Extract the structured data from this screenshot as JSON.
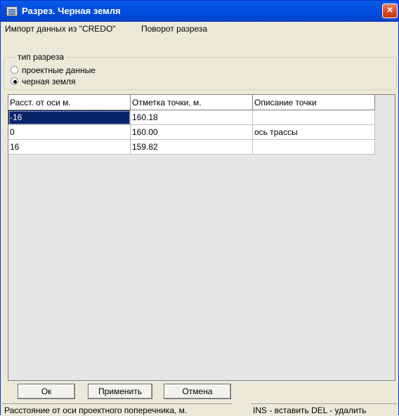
{
  "window": {
    "title": "Разрез. Черная земля",
    "close_glyph": "×"
  },
  "menu": {
    "items": [
      "Импорт данных  из \"CREDO\"",
      "Поворот разреза"
    ]
  },
  "cut_type": {
    "legend": "тип разреза",
    "options": [
      {
        "label": "проектные данные",
        "selected": false
      },
      {
        "label": "черная земля",
        "selected": true
      }
    ]
  },
  "table": {
    "headers": [
      "Расст. от оси  м.",
      "Отметка точки, м.",
      "Описание точки"
    ],
    "rows": [
      [
        "-16",
        "160.18",
        ""
      ],
      [
        "0",
        "160.00",
        "ось трассы"
      ],
      [
        "16",
        "159.82",
        ""
      ]
    ]
  },
  "buttons": {
    "ok": "Ок",
    "apply": "Применить",
    "cancel": "Отмена"
  },
  "status": {
    "left": "Расстояние от оси проектного поперечника, м.",
    "right": "INS - вставить DEL - удалить"
  },
  "colors": {
    "title_bar": "#0350e0",
    "selection": "#0a246a"
  }
}
